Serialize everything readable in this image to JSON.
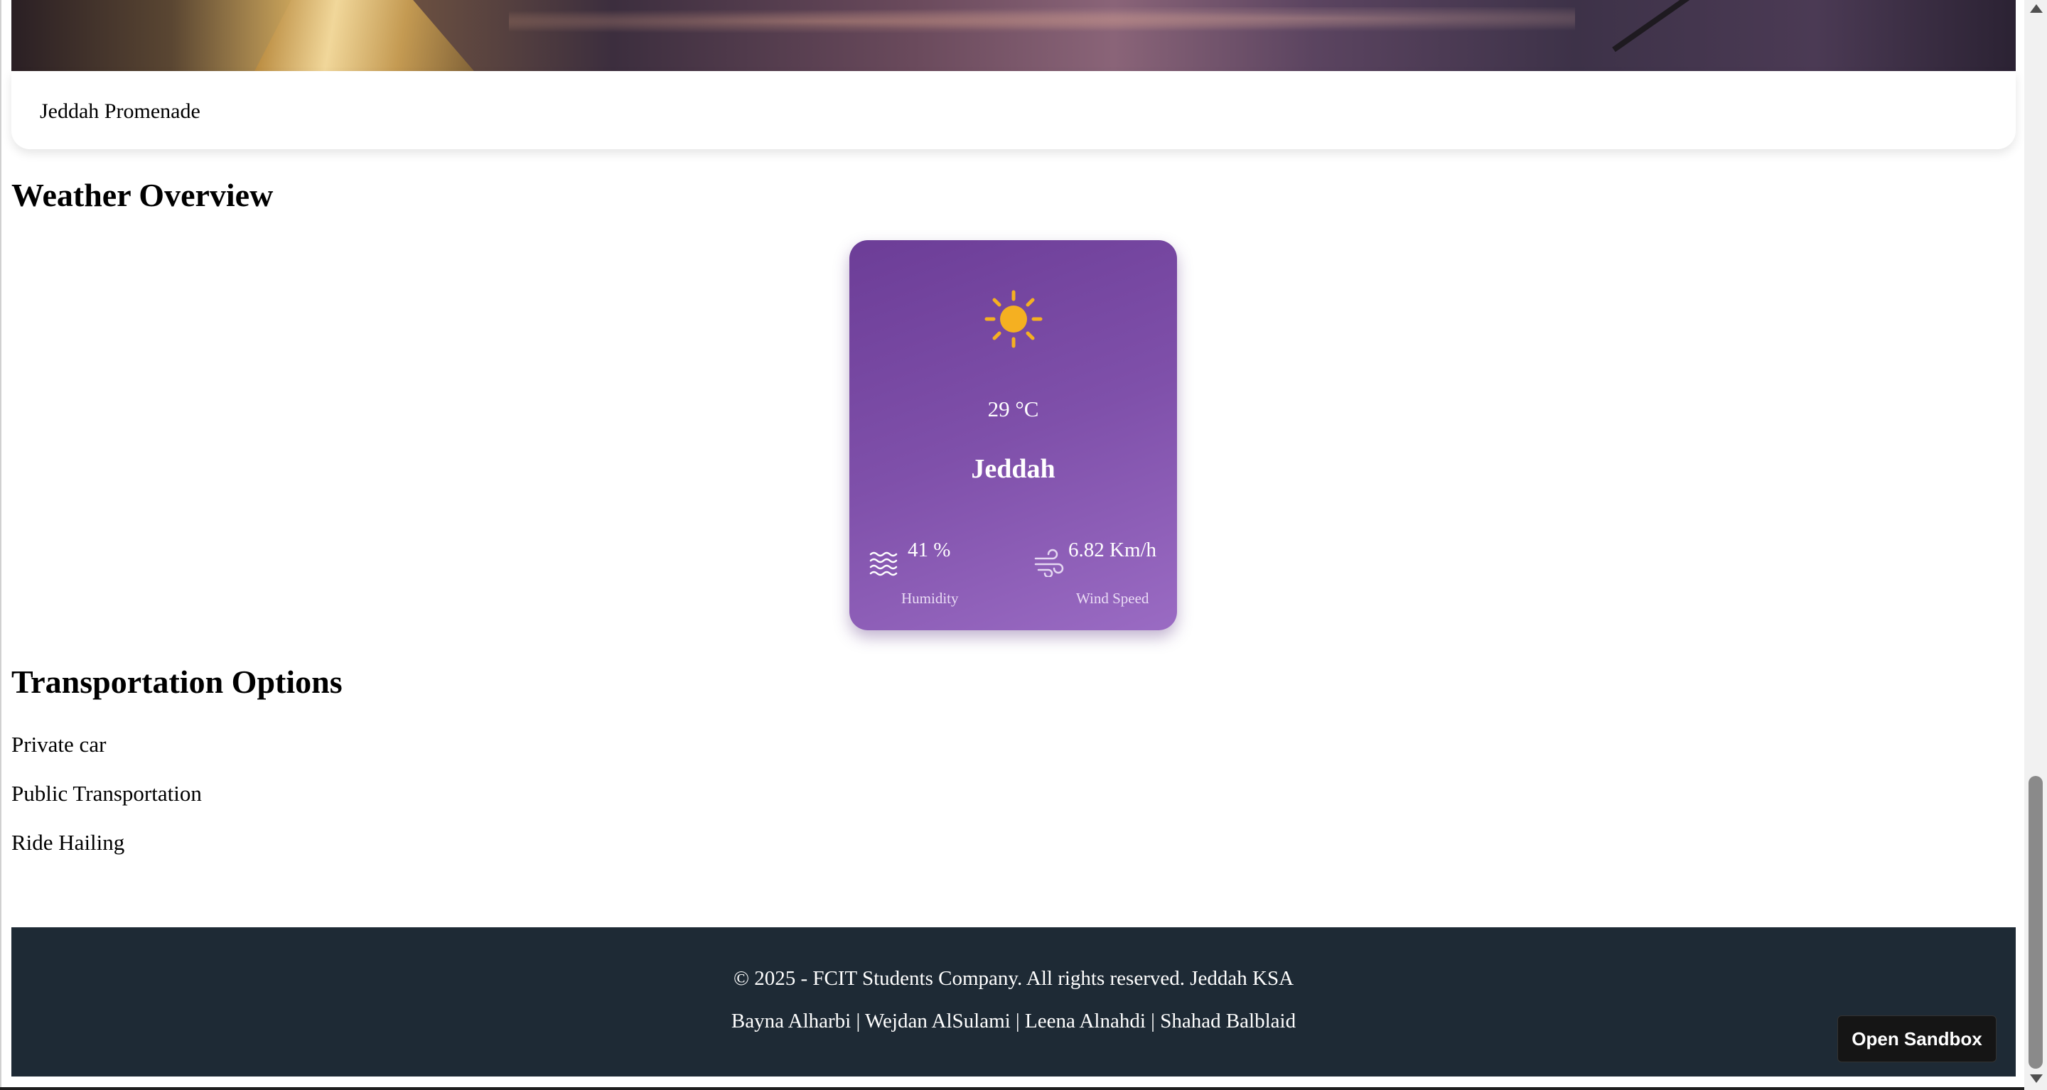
{
  "attraction_card": {
    "caption": "Jeddah Promenade"
  },
  "weather": {
    "heading": "Weather Overview",
    "icon": "sun-icon",
    "temperature": "29 °C",
    "city": "Jeddah",
    "humidity_value": "41 %",
    "humidity_label": "Humidity",
    "humidity_icon": "humidity-waves-icon",
    "wind_value": "6.82 Km/h",
    "wind_label": "Wind Speed",
    "wind_icon": "wind-icon",
    "colors": {
      "card_start": "#6c3d97",
      "card_end": "#9a6bc3",
      "sun": "#f5b021"
    }
  },
  "transport": {
    "heading": "Transportation Options",
    "items": [
      "Private car",
      "Public Transportation",
      "Ride Hailing"
    ]
  },
  "footer": {
    "copyright": "© 2025 - FCIT Students Company. All rights reserved. Jeddah KSA",
    "authors": "Bayna Alharbi | Wejdan AlSulami | Leena Alnahdi | Shahad Balblaid",
    "background": "#1e2a35"
  },
  "sandbox_button": {
    "label": "Open Sandbox"
  }
}
